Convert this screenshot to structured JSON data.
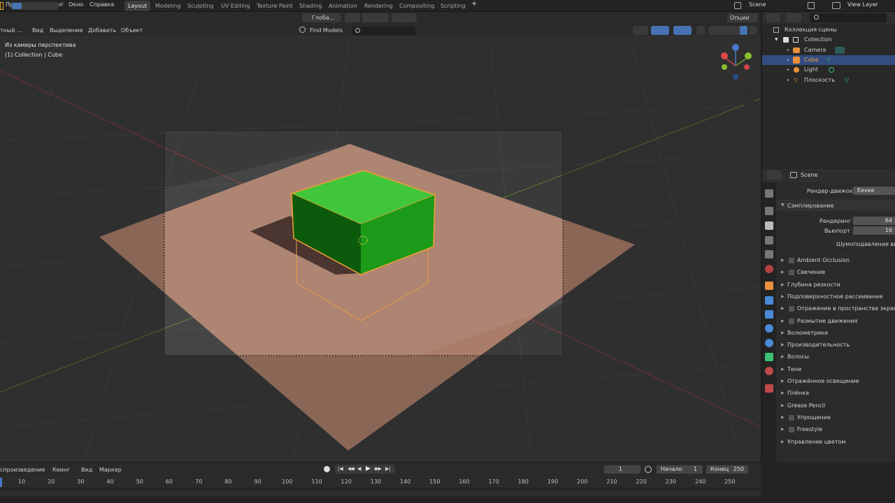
{
  "topbar": {
    "menus": [
      "Правка",
      "Рендеринг",
      "Окно",
      "Справка"
    ],
    "tabs": [
      "Layout",
      "Modeling",
      "Sculpting",
      "UV Editing",
      "Texture Paint",
      "Shading",
      "Animation",
      "Rendering",
      "Compositing",
      "Scripting"
    ],
    "active_tab": "Layout",
    "add_tab": "+",
    "scene": "Scene",
    "view_layer": "View Layer"
  },
  "viewport_header": {
    "mode": "тный ...",
    "menus": [
      "Вид",
      "Выделение",
      "Добавить",
      "Объект"
    ],
    "orientation": "Глоба...",
    "find": "Find Models",
    "options": "Опции"
  },
  "viewport": {
    "view_name": "Из камеры перспектива",
    "collection_info": "(1) Collection | Cube"
  },
  "outliner": {
    "root": "Коллекция сцены",
    "collection": "Collection",
    "items": [
      {
        "name": "Camera",
        "color": "#e8903a"
      },
      {
        "name": "Cube",
        "color": "#e8903a"
      },
      {
        "name": "Light",
        "color": "#e8903a"
      },
      {
        "name": "Плоскость",
        "color": "#e8903a"
      }
    ],
    "selected": "Cube"
  },
  "properties": {
    "context": "Scene",
    "render_engine_label": "Рендер-движок",
    "render_engine": "Eevee",
    "sampling_title": "Сэмплирование",
    "render_label": "Рендеринг",
    "render_value": "64",
    "viewport_label": "Вьюпорт",
    "viewport_value": "16",
    "denoise_label": "Шумоподавление вьюпорта",
    "sections": [
      {
        "label": "Ambient Occlusion",
        "checkbox": true
      },
      {
        "label": "Свечение",
        "checkbox": true
      },
      {
        "label": "Глубина резкости",
        "checkbox": false
      },
      {
        "label": "Подповерхностное рассеивание",
        "checkbox": false
      },
      {
        "label": "Отражение в пространстве экрана",
        "checkbox": true
      },
      {
        "label": "Размытие движения",
        "checkbox": true
      },
      {
        "label": "Волюметрики",
        "checkbox": false
      },
      {
        "label": "Производительность",
        "checkbox": false
      },
      {
        "label": "Волосы",
        "checkbox": false
      },
      {
        "label": "Тени",
        "checkbox": false
      },
      {
        "label": "Отражённое освещение",
        "checkbox": false
      },
      {
        "label": "Плёнка",
        "checkbox": false
      },
      {
        "label": "Grease Pencil",
        "checkbox": false
      },
      {
        "label": "Упрощение",
        "checkbox": true
      },
      {
        "label": "Freestyle",
        "checkbox": true
      },
      {
        "label": "Управление цветом",
        "checkbox": false
      }
    ]
  },
  "timeline": {
    "menus": [
      "спроизведение",
      "Кеинг",
      "Вид",
      "Маркер"
    ],
    "current_frame": "1",
    "start_label": "Начало",
    "start": "1",
    "end_label": "Конец",
    "end": "250",
    "ticks": [
      "10",
      "20",
      "30",
      "40",
      "50",
      "60",
      "70",
      "80",
      "90",
      "100",
      "110",
      "120",
      "130",
      "140",
      "150",
      "160",
      "170",
      "180",
      "190",
      "200",
      "210",
      "220",
      "230",
      "240",
      "250"
    ]
  },
  "colors": {
    "selection": "#334d80",
    "cube_green": "#22a01f",
    "plane": "#c08c74",
    "outline": "#f0a030"
  }
}
